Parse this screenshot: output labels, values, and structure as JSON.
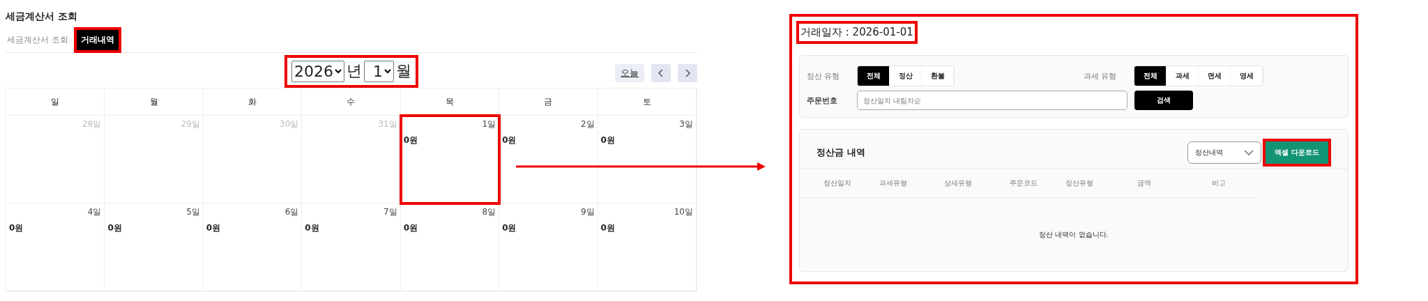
{
  "page_title": "세금계산서 조회",
  "tabs": [
    {
      "label": "세금계산서 조회",
      "selected": false,
      "highlighted": false
    },
    {
      "label": "거래내역",
      "selected": true,
      "highlighted": true
    }
  ],
  "calendar": {
    "year": "2026",
    "year_suffix": "년",
    "month": "1",
    "month_suffix": "월",
    "period_highlighted": true,
    "today_button": "오늘",
    "weekdays": [
      "일",
      "월",
      "화",
      "수",
      "목",
      "금",
      "토"
    ],
    "weeks": [
      [
        {
          "day": "28일",
          "other_month": true,
          "highlighted": false
        },
        {
          "day": "29일",
          "other_month": true,
          "highlighted": false
        },
        {
          "day": "30일",
          "other_month": true,
          "highlighted": false
        },
        {
          "day": "31일",
          "other_month": true,
          "highlighted": false
        },
        {
          "day": "1일",
          "amount": "0원",
          "other_month": false,
          "highlighted": true
        },
        {
          "day": "2일",
          "amount": "0원",
          "other_month": false,
          "highlighted": false
        },
        {
          "day": "3일",
          "amount": "0원",
          "other_month": false,
          "highlighted": false
        }
      ],
      [
        {
          "day": "4일",
          "amount": "0원",
          "other_month": false,
          "highlighted": false
        },
        {
          "day": "5일",
          "amount": "0원",
          "other_month": false,
          "highlighted": false
        },
        {
          "day": "6일",
          "amount": "0원",
          "other_month": false,
          "highlighted": false
        },
        {
          "day": "7일",
          "amount": "0원",
          "other_month": false,
          "highlighted": false
        },
        {
          "day": "8일",
          "amount": "0원",
          "other_month": false,
          "highlighted": false
        },
        {
          "day": "9일",
          "amount": "0원",
          "other_month": false,
          "highlighted": false
        },
        {
          "day": "10일",
          "amount": "0원",
          "other_month": false,
          "highlighted": false
        }
      ]
    ]
  },
  "detail": {
    "date_label": "거래일자 : 2026-01-01",
    "date_highlighted": true,
    "settlement_type": {
      "label": "정산 유형",
      "options": [
        {
          "label": "전체",
          "selected": true
        },
        {
          "label": "정산",
          "selected": false
        },
        {
          "label": "환불",
          "selected": false
        }
      ]
    },
    "tax_type": {
      "label": "과세 유형",
      "options": [
        {
          "label": "전체",
          "selected": true
        },
        {
          "label": "과세",
          "selected": false
        },
        {
          "label": "면세",
          "selected": false
        },
        {
          "label": "영세",
          "selected": false
        }
      ]
    },
    "order_number": {
      "label": "주문번호",
      "placeholder": "정산일자 내림차순"
    },
    "search_button": "검색",
    "section_title": "정산금 내역",
    "dropdown_value": "정산내역",
    "excel_button": "엑셀 다운로드",
    "excel_highlighted": true,
    "columns": [
      "정산일자",
      "과세유형",
      "상세유형",
      "주문코드",
      "정산유형",
      "금액",
      "비고"
    ],
    "empty_message": "정산 내역이 없습니다."
  }
}
